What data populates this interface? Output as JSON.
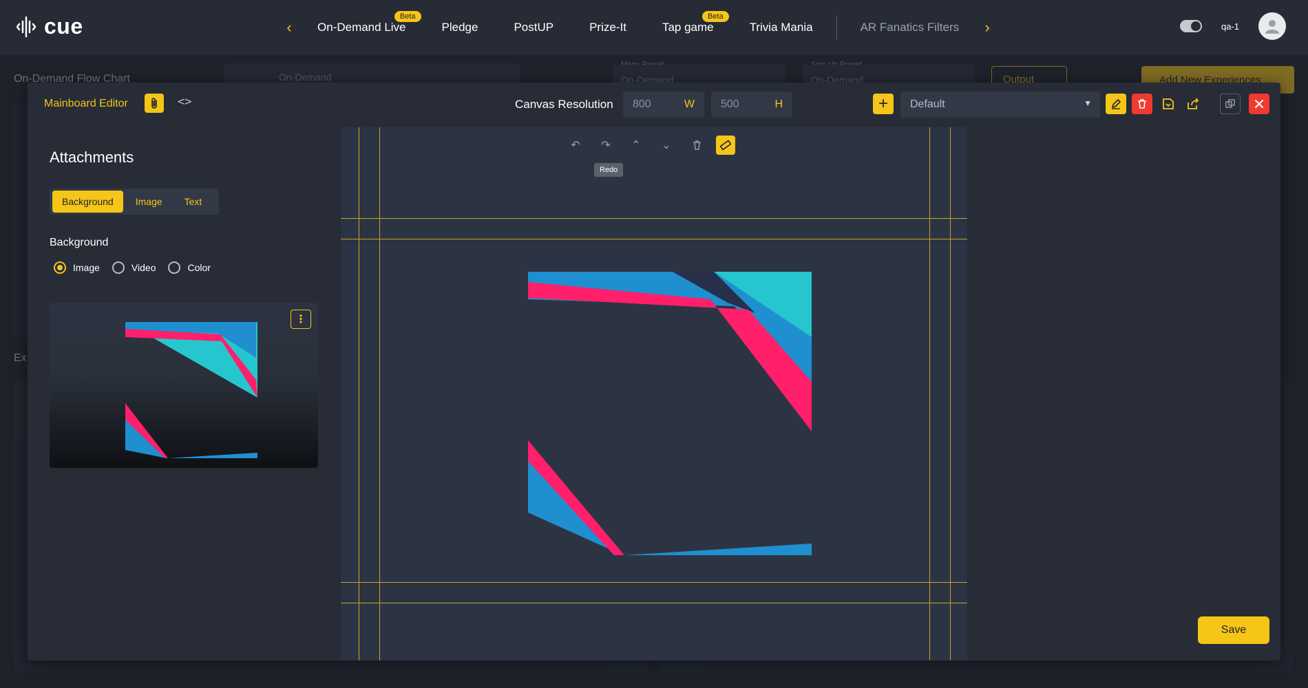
{
  "app": {
    "logo_text": "cue"
  },
  "nav": {
    "items": [
      {
        "label": "On-Demand Live",
        "badge": "Beta"
      },
      {
        "label": "Pledge"
      },
      {
        "label": "PostUP"
      },
      {
        "label": "Prize-It"
      },
      {
        "label": "Tap game",
        "badge": "Beta"
      },
      {
        "label": "Trivia Mania"
      },
      {
        "label": "AR Fanatics Filters"
      }
    ]
  },
  "user": {
    "name": "qa-1"
  },
  "background_page": {
    "title": "On-Demand Flow Chart",
    "flow_select": "On-Demand",
    "menu_preset_label": "Menu Preset",
    "menu_preset_value": "On-Demand",
    "signup_preset_label": "Sign Up Preset",
    "signup_preset_value": "On-Demand",
    "output_label": "Output",
    "add_button": "Add New Experiences",
    "section_partial": "Ex"
  },
  "editor": {
    "title": "Mainboard Editor",
    "resolution_label": "Canvas Resolution",
    "width_value": "800",
    "width_unit": "W",
    "height_value": "500",
    "height_unit": "H",
    "preset_value": "Default",
    "save_label": "Save"
  },
  "attachments": {
    "title": "Attachments",
    "tabs": [
      "Background",
      "Image",
      "Text"
    ],
    "active_tab": "Background",
    "background_heading": "Background",
    "radio_options": [
      "Image",
      "Video",
      "Color"
    ],
    "selected_radio": "Image"
  },
  "canvas": {
    "tooltip": "Redo"
  },
  "colors": {
    "accent": "#f5c518",
    "danger": "#f0392f",
    "pink": "#ff1f6b",
    "blue": "#1f8fd0",
    "teal": "#26c6cf"
  }
}
